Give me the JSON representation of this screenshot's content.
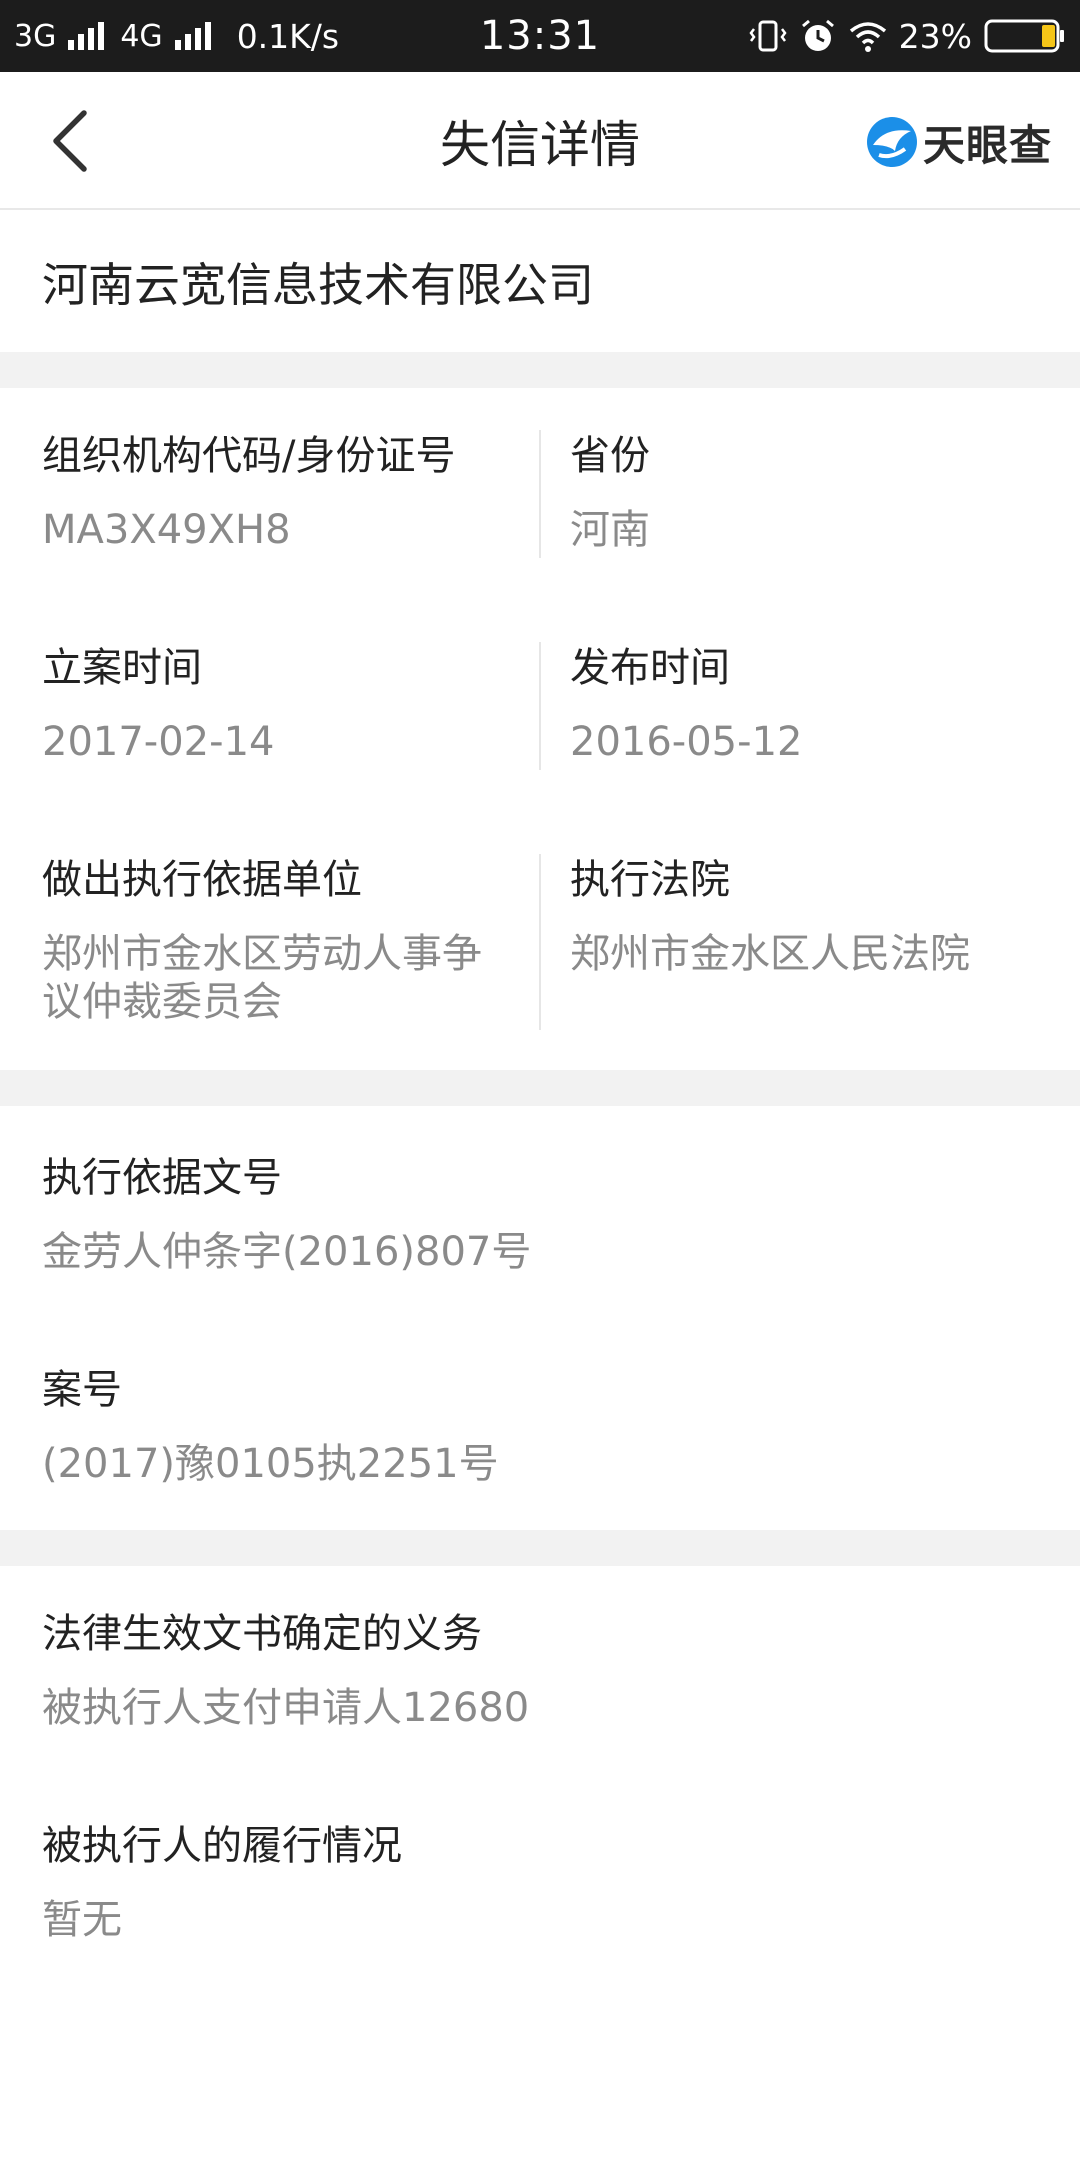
{
  "status_bar": {
    "network_3g": "3G",
    "network_4g": "4G",
    "speed": "0.1K/s",
    "time": "13:31",
    "battery": "23%"
  },
  "header": {
    "title": "失信详情",
    "brand_name": "天眼查",
    "brand_color": "#1b8fe8"
  },
  "company": {
    "name": "河南云宽信息技术有限公司"
  },
  "info_grid": {
    "org_code_label": "组织机构代码/身份证号",
    "org_code_value": "MA3X49XH8",
    "province_label": "省份",
    "province_value": "河南",
    "filing_date_label": "立案时间",
    "filing_date_value": "2017-02-14",
    "publish_date_label": "发布时间",
    "publish_date_value": "2016-05-12",
    "basis_unit_label": "做出执行依据单位",
    "basis_unit_value": "郑州市金水区劳动人事争议仲裁委员会",
    "court_label": "执行法院",
    "court_value": "郑州市金水区人民法院"
  },
  "case_info": {
    "doc_no_label": "执行依据文号",
    "doc_no_value": "金劳人仲条字(2016)807号",
    "case_no_label": "案号",
    "case_no_value": "(2017)豫0105执2251号"
  },
  "obligation": {
    "duty_label": "法律生效文书确定的义务",
    "duty_value": "被执行人支付申请人12680",
    "performance_label": "被执行人的履行情况",
    "performance_value": "暂无"
  }
}
